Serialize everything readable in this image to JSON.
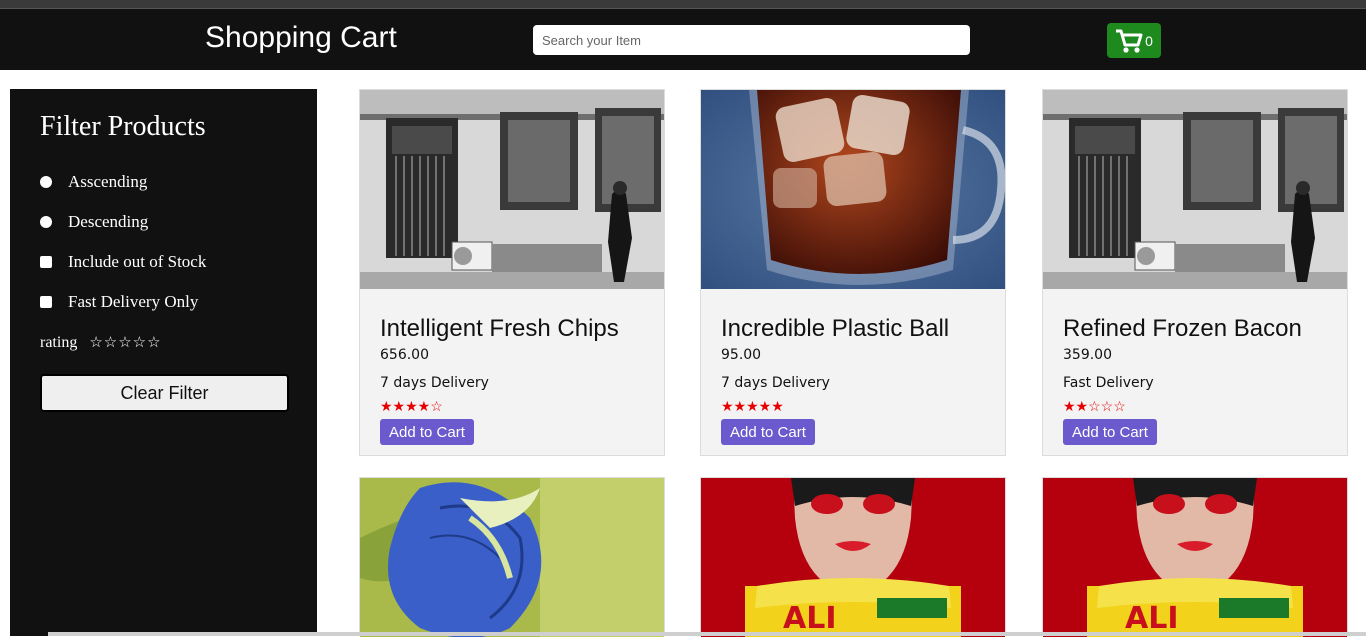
{
  "header": {
    "title": "Shopping Cart",
    "search_placeholder": "Search your Item",
    "search_value": "",
    "cart_count": "0"
  },
  "sidebar": {
    "title": "Filter Products",
    "ascending_label": "Asscending",
    "descending_label": "Descending",
    "out_of_stock_label": "Include out of Stock",
    "fast_delivery_label": "Fast Delivery Only",
    "rating_label": "rating",
    "rating_stars": "☆☆☆☆☆",
    "clear_button": "Clear Filter"
  },
  "products": [
    {
      "name": "Intelligent Fresh Chips",
      "price": "656.00",
      "delivery": "7 days Delivery",
      "rating": 4,
      "stars": "★★★★☆",
      "add_label": "Add to Cart",
      "image": "street-photo"
    },
    {
      "name": "Incredible Plastic Ball",
      "price": "95.00",
      "delivery": "7 days Delivery",
      "rating": 5,
      "stars": "★★★★★",
      "add_label": "Add to Cart",
      "image": "iced-tea-photo"
    },
    {
      "name": "Refined Frozen Bacon",
      "price": "359.00",
      "delivery": "Fast Delivery",
      "rating": 2,
      "stars": "★★☆☆☆",
      "add_label": "Add to Cart",
      "image": "street-photo"
    },
    {
      "image": "blue-flower-photo"
    },
    {
      "image": "mask-photo"
    },
    {
      "image": "mask-photo"
    }
  ],
  "colors": {
    "header_bg": "#111111",
    "cart_green": "#1e8a1e",
    "button_purple": "#6a5acd",
    "star_red": "#e60000"
  }
}
